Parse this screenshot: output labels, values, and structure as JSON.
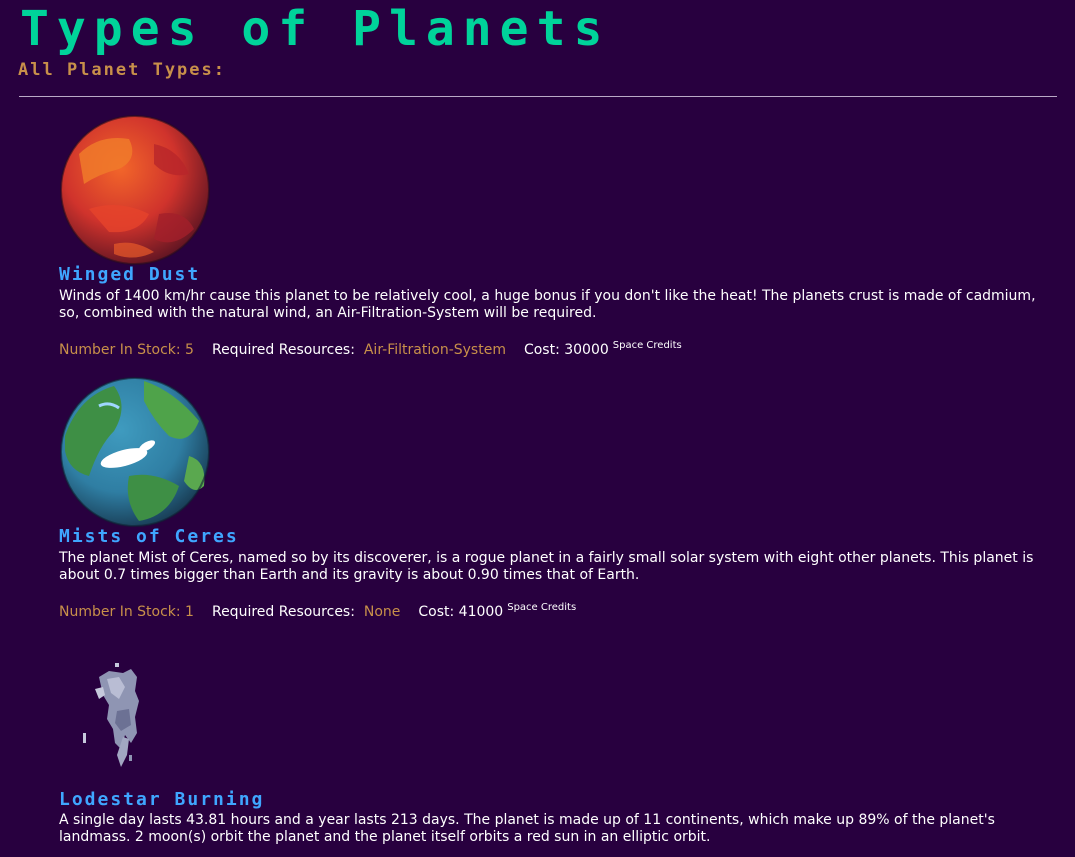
{
  "header": {
    "title": "Types of Planets",
    "subtitle": "All Planet Types:"
  },
  "planets": [
    {
      "name": "Winged Dust",
      "description": "Winds of 1400 km/hr cause this planet to be relatively cool, a huge bonus if you don't like the heat! The planets crust is made of cadmium, so, combined with the natural wind, an Air-Filtration-System will be required.",
      "stock_label": "Number In Stock: 5",
      "resources_label": "Required Resources:",
      "resources_value": "Air-Filtration-System",
      "cost_label": "Cost: 30000",
      "cost_unit": "Space Credits",
      "image_icon": "red-planet-icon",
      "colors": {
        "base": "#c9302c",
        "highlight": "#f2662a"
      }
    },
    {
      "name": "Mists of Ceres",
      "description": "The planet Mist of Ceres, named so by its discoverer, is a rogue planet in a fairly small solar system with eight other planets. This planet is about 0.7 times bigger than Earth and its gravity is about 0.90 times that of Earth.",
      "stock_label": "Number In Stock: 1",
      "resources_label": "Required Resources:",
      "resources_value": "None",
      "cost_label": "Cost: 41000",
      "cost_unit": "Space Credits",
      "image_icon": "earthlike-planet-icon",
      "colors": {
        "land": "#3e8f45",
        "water": "#2f7ea3"
      }
    },
    {
      "name": "Lodestar Burning",
      "description": "A single day lasts 43.81 hours and a year lasts 213 days. The planet is made up of 11 continents, which make up 89% of the planet's landmass. 2 moon(s) orbit the planet and the planet itself orbits a red sun in an elliptic orbit.",
      "image_icon": "shattered-planet-icon",
      "colors": {
        "rock": "#8f95b3"
      }
    }
  ],
  "colors": {
    "background": "#28003f",
    "title": "#00d39a",
    "subtitle": "#c8904a",
    "planet_name": "#3fa6ff"
  }
}
